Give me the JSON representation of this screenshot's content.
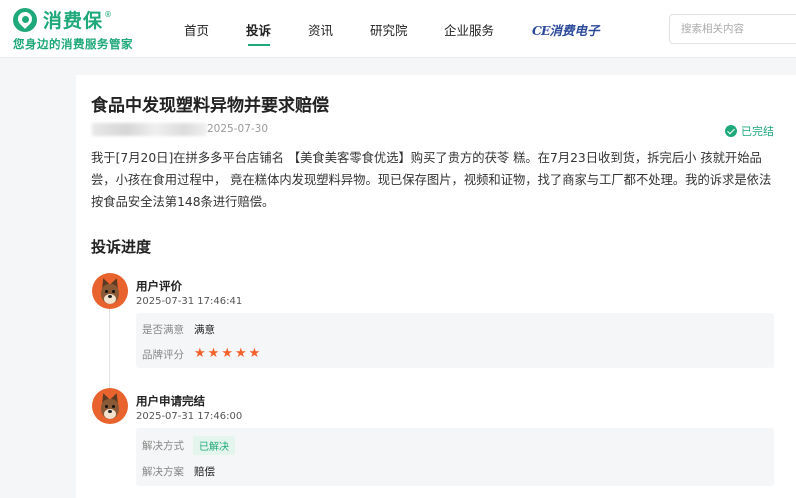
{
  "brand": {
    "name": "消费保",
    "registered": "®",
    "slogan": "您身边的消费服务管家",
    "accent": "#1fa87a"
  },
  "nav": {
    "items": [
      {
        "label": "首页",
        "active": false
      },
      {
        "label": "投诉",
        "active": true
      },
      {
        "label": "资讯",
        "active": false
      },
      {
        "label": "研究院",
        "active": false
      },
      {
        "label": "企业服务",
        "active": false
      }
    ],
    "partner_prefix": "CE",
    "partner_label": "消费电子"
  },
  "search": {
    "placeholder": "搜索相关内容",
    "value": ""
  },
  "complaint": {
    "title": "食品中发现塑料异物并要求赔偿",
    "date": "2025-07-30",
    "status": "已完结",
    "description": "我于[7月20日]在拼多多平台店铺名 【美食美客零食优选】购买了贵方的茯苓 糕。在7月23日收到货，拆完后小 孩就开始品尝，小孩在食用过程中， 竟在糕体内发现塑料异物。现已保存图片，视频和证物，找了商家与工厂都不处理。我的诉求是依法按食品安全法第148条进行赔偿。"
  },
  "progress": {
    "section_title": "投诉进度",
    "events": [
      {
        "title": "用户评价",
        "time": "2025-07-31 17:46:41",
        "satisfied_label": "是否满意",
        "satisfied_value": "满意",
        "rating_label": "品牌评分",
        "rating": 5,
        "star": "★"
      },
      {
        "title": "用户申请完结",
        "time": "2025-07-31 17:46:00",
        "method_label": "解决方式",
        "method_value": "已解决",
        "plan_label": "解决方案",
        "plan_value": "赔偿"
      }
    ]
  },
  "colors": {
    "star": "#f5612a",
    "avatar_bg": "#e8632e",
    "partner": "#2c4a9a"
  }
}
